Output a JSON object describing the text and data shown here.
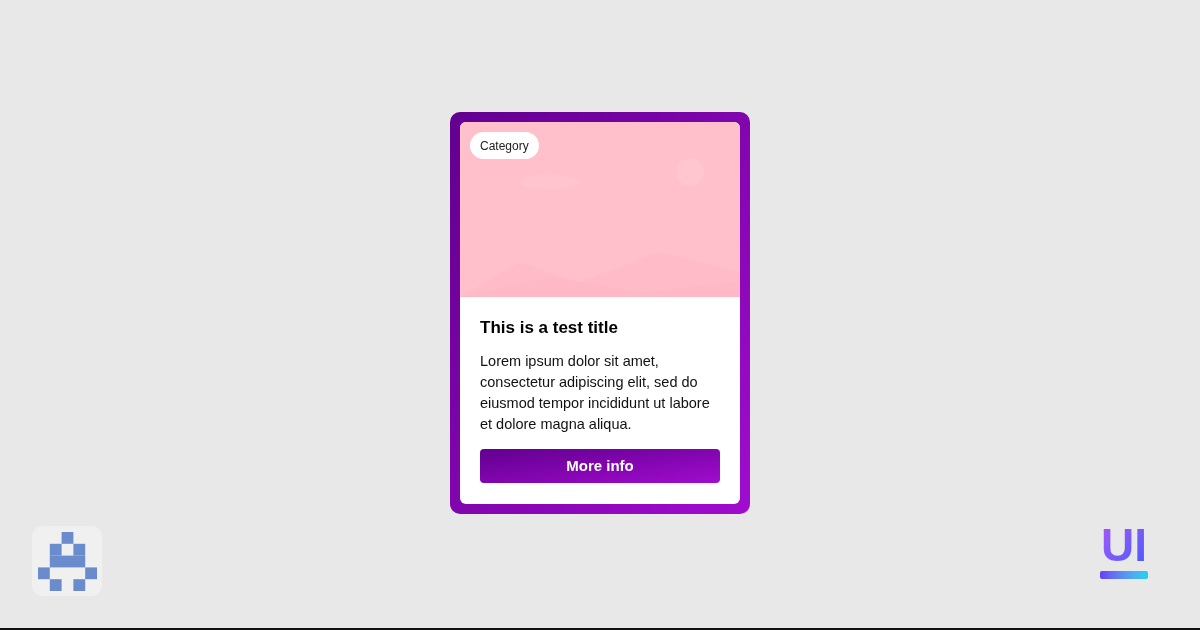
{
  "card": {
    "badge": "Category",
    "title": "This is a test title",
    "description": "Lorem ipsum dolor sit amet, consectetur adipiscing elit, sed do eiusmod tempor incididunt ut labore et dolore magna aliqua.",
    "button": "More info"
  },
  "logo": {
    "text": "UI"
  }
}
